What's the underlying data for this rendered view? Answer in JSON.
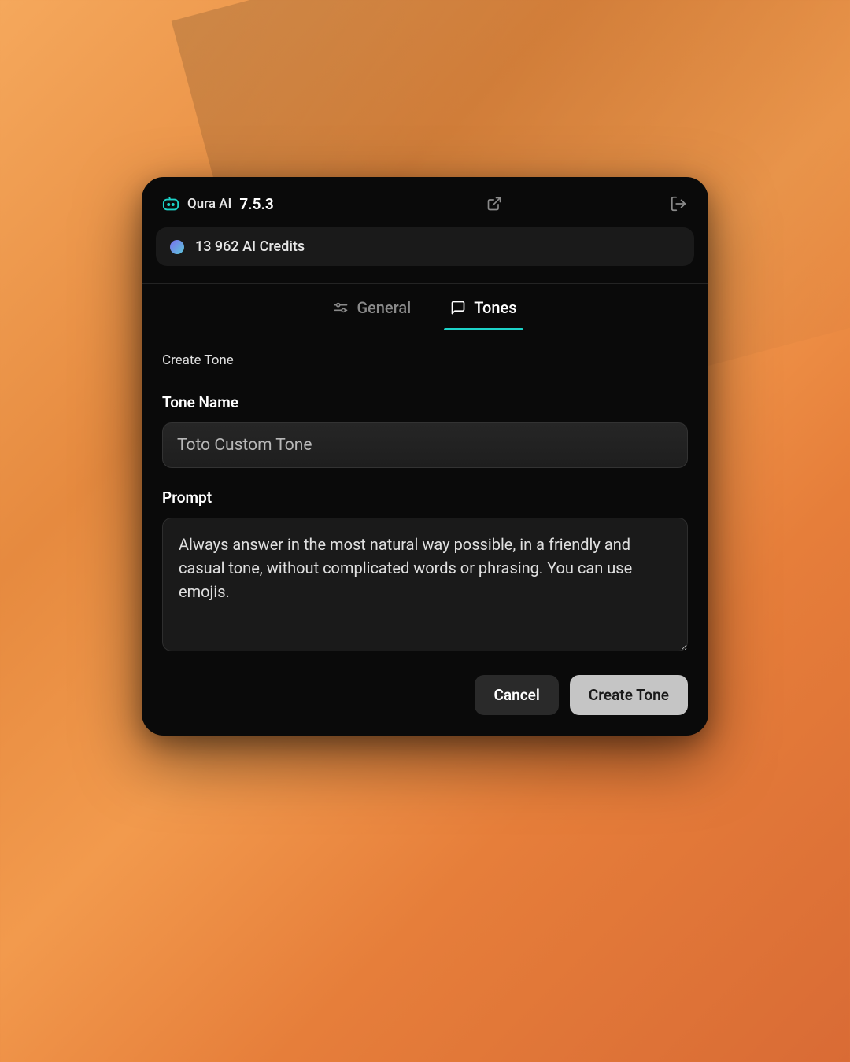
{
  "header": {
    "app_name": "Qura AI",
    "version": "7.5.3"
  },
  "credits": {
    "text": "13 962 AI Credits"
  },
  "tabs": {
    "general": "General",
    "tones": "Tones"
  },
  "form": {
    "section_title": "Create Tone",
    "tone_name_label": "Tone Name",
    "tone_name_value": "Toto Custom Tone",
    "prompt_label": "Prompt",
    "prompt_value": "Always answer in the most natural way possible, in a friendly and casual tone, without complicated words or phrasing. You can use emojis."
  },
  "buttons": {
    "cancel": "Cancel",
    "create": "Create Tone"
  }
}
